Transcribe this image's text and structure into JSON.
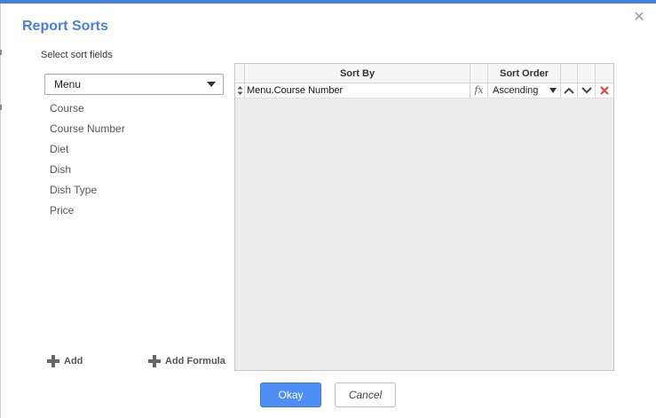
{
  "dialog": {
    "title": "Report Sorts",
    "close_icon": "close-icon",
    "close_glyph": "✕",
    "subtitle": "Select sort fields"
  },
  "source_select": {
    "value": "Menu"
  },
  "fields": [
    "Course",
    "Course Number",
    "Diet",
    "Dish",
    "Dish Type",
    "Price"
  ],
  "actions": {
    "add_label": "Add",
    "add_formula_label": "Add Formula"
  },
  "grid": {
    "headers": {
      "sort_by": "Sort By",
      "sort_order": "Sort Order"
    },
    "rows": [
      {
        "sort_by": "Menu.Course Number",
        "formula_glyph": "fx",
        "sort_order": "Ascending"
      }
    ]
  },
  "buttons": {
    "okay": "Okay",
    "cancel": "Cancel"
  },
  "colors": {
    "accent": "#4a7fd6",
    "primary_button": "#4d8ef7",
    "delete_icon": "#e0403a"
  }
}
